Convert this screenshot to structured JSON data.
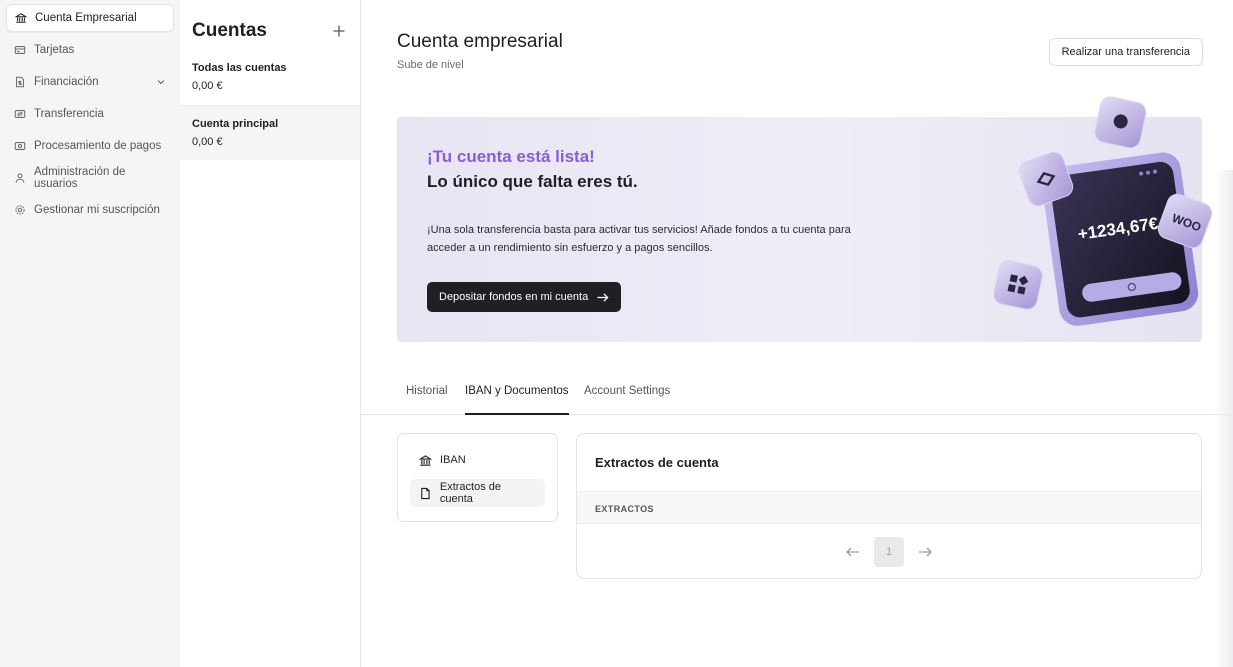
{
  "sidebar": {
    "items": [
      {
        "label": "Cuenta Empresarial",
        "icon": "bank-icon",
        "active": true
      },
      {
        "label": "Tarjetas",
        "icon": "card-icon"
      },
      {
        "label": "Financiación",
        "icon": "document-money-icon",
        "expandable": true
      },
      {
        "label": "Transferencia",
        "icon": "transfer-icon"
      },
      {
        "label": "Procesamiento de pagos",
        "icon": "payment-icon"
      },
      {
        "label": "Administración de usuarios",
        "icon": "user-icon"
      },
      {
        "label": "Gestionar mi suscripción",
        "icon": "gear-icon"
      }
    ]
  },
  "accounts": {
    "title": "Cuentas",
    "list": [
      {
        "name": "Todas las cuentas",
        "balance": "0,00 €"
      },
      {
        "name": "Cuenta principal",
        "balance": "0,00 €",
        "selected": true
      }
    ]
  },
  "main": {
    "title": "Cuenta empresarial",
    "subtitle": "Sube de nivel",
    "transfer_button": "Realizar una transferencia",
    "banner": {
      "headline_accent": "¡Tu cuenta está lista!",
      "headline": "Lo único que falta eres tú.",
      "description": "¡Una sola transferencia basta para activar tus servicios! Añade fondos a tu cuenta para acceder a un rendimiento sin esfuerzo y a pagos sencillos.",
      "cta": "Depositar fondos en mi cuenta",
      "phone_amount": "+1234,67€",
      "badge_text": "WOO",
      "accent_color": "#8a5cd6"
    },
    "tabs": [
      {
        "label": "Historial"
      },
      {
        "label": "IBAN y Documentos",
        "active": true
      },
      {
        "label": "Account Settings"
      }
    ],
    "doc_nav": [
      {
        "label": "IBAN",
        "icon": "bank-icon"
      },
      {
        "label": "Extractos de cuenta",
        "icon": "file-icon",
        "selected": true
      }
    ],
    "statements": {
      "title": "Extractos de cuenta",
      "column_header": "EXTRACTOS",
      "current_page": "1"
    }
  }
}
